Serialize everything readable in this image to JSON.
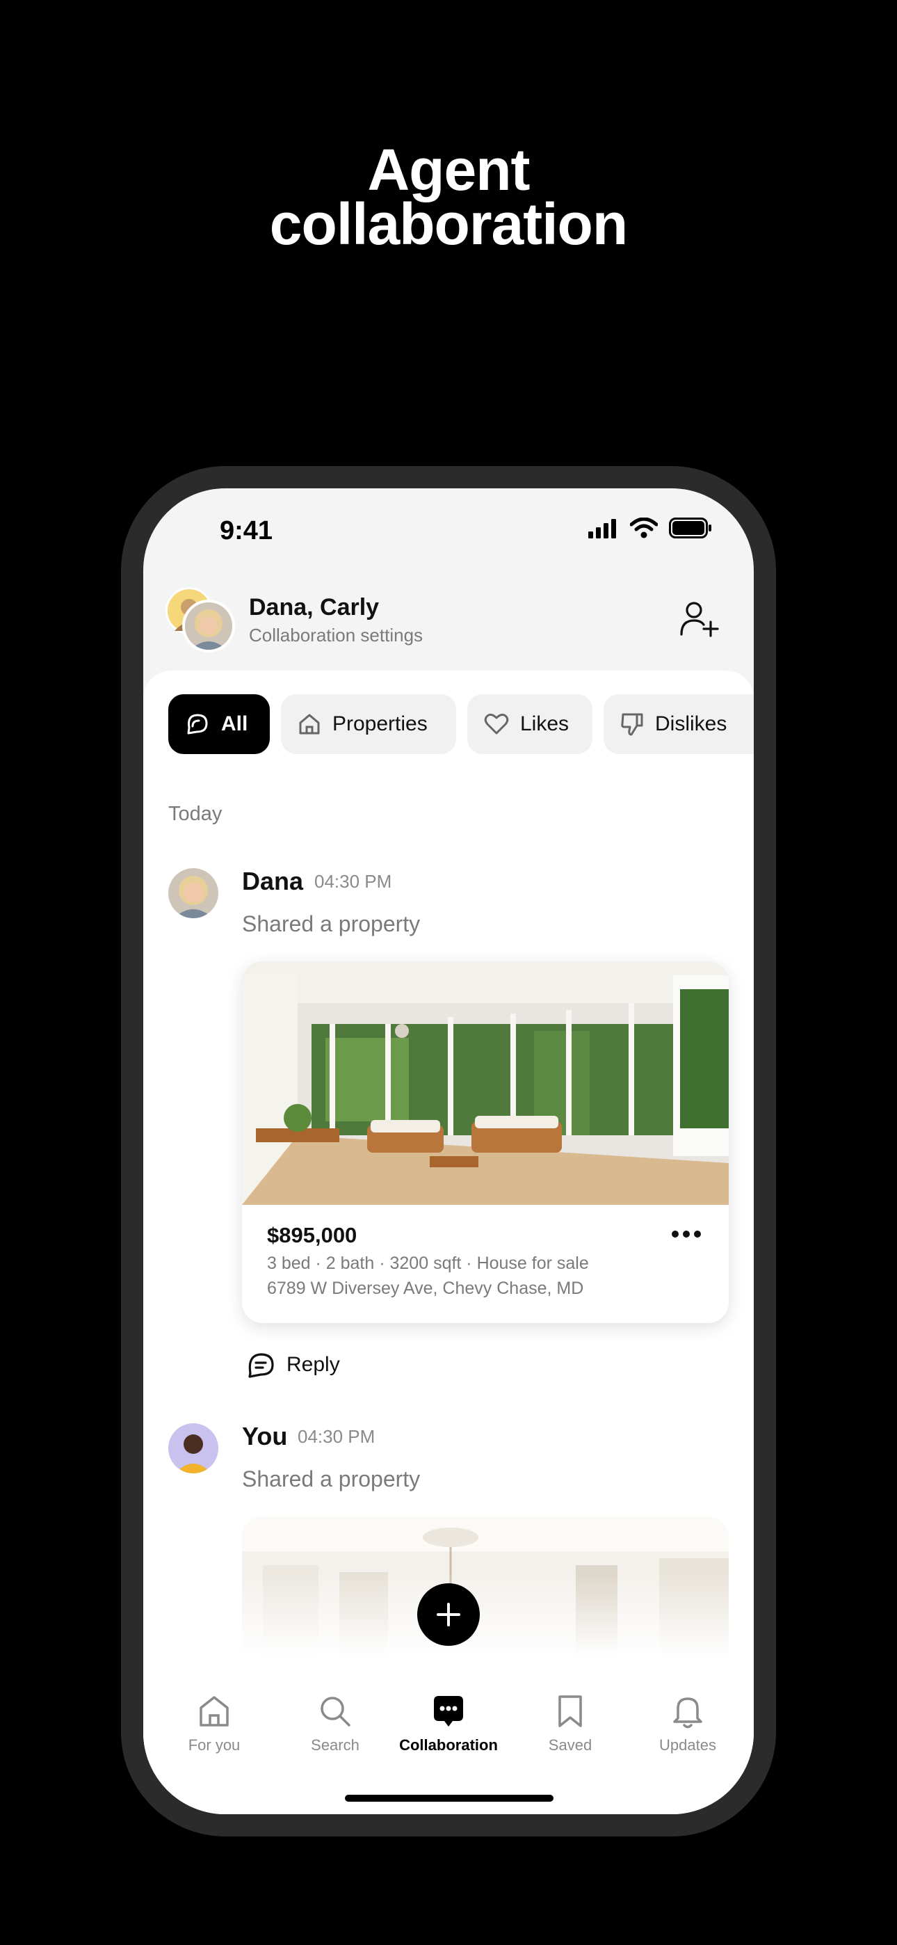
{
  "headline": [
    "Agent",
    "collaboration"
  ],
  "status_bar": {
    "time": "9:41"
  },
  "header": {
    "names": "Dana, Carly",
    "subtitle": "Collaboration settings"
  },
  "filters": [
    {
      "label": "All",
      "icon": "chat-bubbles-icon",
      "active": true
    },
    {
      "label": "Properties",
      "icon": "home-icon",
      "active": false
    },
    {
      "label": "Likes",
      "icon": "heart-icon",
      "active": false
    },
    {
      "label": "Dislikes",
      "icon": "thumbs-down-icon",
      "active": false
    }
  ],
  "feed": {
    "section": "Today",
    "messages": [
      {
        "sender": "Dana",
        "time": "04:30 PM",
        "action": "Shared a property",
        "property": {
          "price": "$895,000",
          "details": "3 bed · 2 bath · 3200 sqft · House for sale",
          "address": "6789 W Diversey Ave, Chevy Chase, MD"
        },
        "reply_label": "Reply"
      },
      {
        "sender": "You",
        "time": "04:30 PM",
        "action": "Shared a property"
      }
    ]
  },
  "tabs": [
    {
      "label": "For you",
      "icon": "home-icon",
      "active": false
    },
    {
      "label": "Search",
      "icon": "search-icon",
      "active": false
    },
    {
      "label": "Collaboration",
      "icon": "chat-icon",
      "active": true
    },
    {
      "label": "Saved",
      "icon": "bookmark-icon",
      "active": false
    },
    {
      "label": "Updates",
      "icon": "bell-icon",
      "active": false
    }
  ],
  "colors": {
    "accent": "#000000",
    "muted": "#7a7a7a",
    "background": "#000000"
  }
}
